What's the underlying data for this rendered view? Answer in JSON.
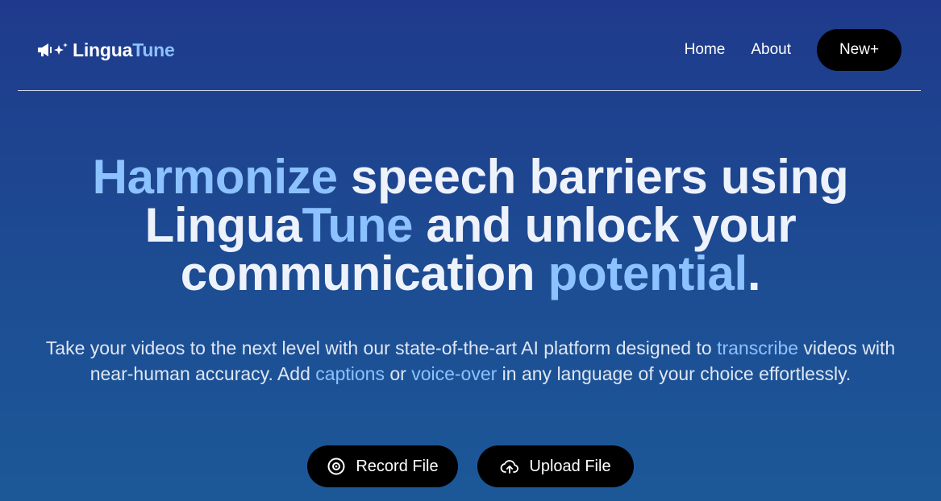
{
  "brand": {
    "name_part1": "Lingua",
    "name_part2": "Tune",
    "icon": "megaphone-sparkle-icon"
  },
  "nav": {
    "home": "Home",
    "about": "About",
    "new_button": "New+"
  },
  "hero": {
    "title": {
      "w1": "Harmonize",
      "t1": " speech barriers using ",
      "w2a": "Lingua",
      "w2b": "Tune",
      "t2": " and unlock your communication ",
      "w3": "potential",
      "t3": "."
    },
    "subtitle": {
      "s1": "Take your videos to the next level with our state-of-the-art AI platform designed to ",
      "l1": "transcribe",
      "s2": " videos with near-human accuracy. Add ",
      "l2": "captions",
      "s3": " or ",
      "l3": "voice-over",
      "s4": " in any language of your choice effortlessly."
    }
  },
  "actions": {
    "record": {
      "label": "Record File",
      "icon": "record-icon"
    },
    "upload": {
      "label": "Upload File",
      "icon": "cloud-upload-icon"
    }
  },
  "colors": {
    "accent": "#8cc2ff",
    "background_top": "#1f3a8c",
    "background_bottom": "#1c5898",
    "button": "#000000"
  }
}
